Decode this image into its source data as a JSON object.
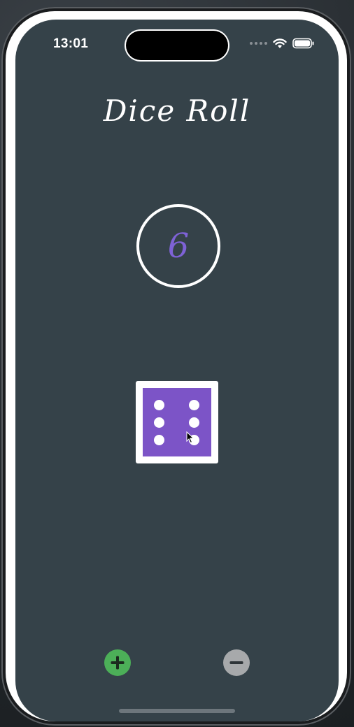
{
  "status_bar": {
    "time": "13:01",
    "icons": [
      "signal-icon",
      "wifi-icon",
      "battery-icon"
    ]
  },
  "app": {
    "title": "Dice Roll",
    "result": "6"
  },
  "die": {
    "value": 6,
    "face_color": "#7c54c7",
    "pip_color": "#ffffff"
  },
  "controls": {
    "add_icon": "plus-icon",
    "remove_icon": "minus-icon",
    "add_color": "#4caf58",
    "remove_color": "#a7a9ab"
  },
  "colors": {
    "background": "#354249",
    "result_text": "#7e62d6"
  }
}
